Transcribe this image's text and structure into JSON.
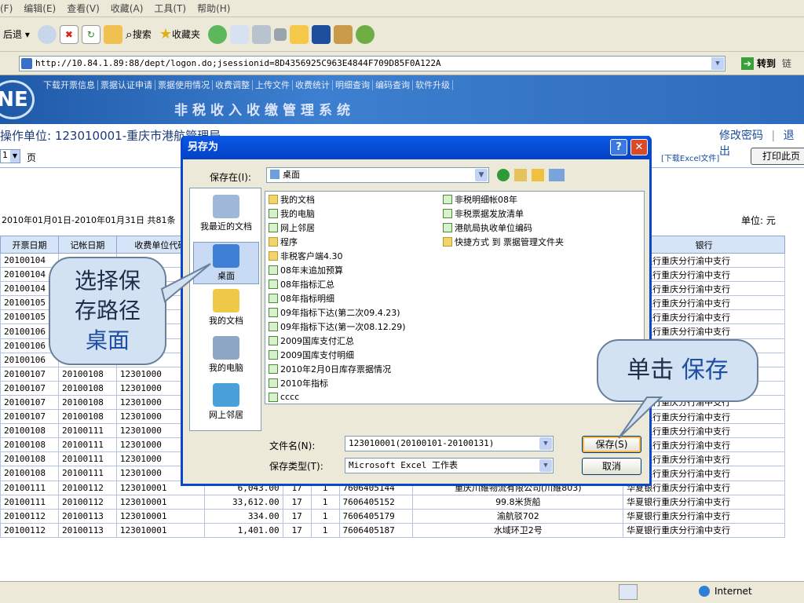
{
  "menu": [
    "(F)",
    "编辑(E)",
    "查看(V)",
    "收藏(A)",
    "工具(T)",
    "帮助(H)"
  ],
  "toolbar": {
    "back": "后退",
    "search": "搜索",
    "favorites": "收藏夹"
  },
  "address": {
    "label": "址(D)",
    "url": "http://10.84.1.89:88/dept/logon.do;jsessionid=8D4356925C963E4844F709D85F0A122A",
    "go": "转到",
    "links": "链"
  },
  "banner": {
    "logo": "NE",
    "nav": [
      "下载开票信息",
      "票据认证申请",
      "票据使用情况",
      "收费调整",
      "上传文件",
      "收费统计",
      "明细查询",
      "编码查询",
      "软件升级"
    ],
    "system_title": "非税收入收缴管理系统"
  },
  "opbar": {
    "unit_label": "操作单位: 123010001-重庆市港航管理局",
    "change_pwd": "修改密码",
    "logout": "退出"
  },
  "pagebar": {
    "page_value": "1",
    "page_suffix": "页",
    "download_excel": "[下载Excel文件]",
    "print": "打印此页"
  },
  "summary": {
    "date_range": "2010年01月01日-2010年01月31日  共81条",
    "unit": "单位: 元"
  },
  "table": {
    "headers": [
      "开票日期",
      "记帐日期",
      "收费单位代码",
      "",
      "",
      "",
      "",
      "",
      "银行"
    ],
    "rows": [
      [
        "20100104",
        "",
        "",
        "",
        "",
        "",
        "",
        "",
        "华夏银行重庆分行渝中支行"
      ],
      [
        "20100104",
        "",
        "",
        "",
        "",
        "",
        "",
        "",
        "华夏银行重庆分行渝中支行"
      ],
      [
        "20100104",
        "",
        "",
        "",
        "",
        "",
        "",
        "",
        "华夏银行重庆分行渝中支行"
      ],
      [
        "20100105",
        "",
        "",
        "",
        "",
        "",
        "",
        "",
        "华夏银行重庆分行渝中支行"
      ],
      [
        "20100105",
        "",
        "",
        "",
        "",
        "",
        "",
        "",
        "华夏银行重庆分行渝中支行"
      ],
      [
        "20100106",
        "",
        "",
        "",
        "",
        "",
        "",
        "",
        "华夏银行重庆分行渝中支行"
      ],
      [
        "20100106",
        "",
        "",
        "",
        "",
        "",
        "",
        "",
        "行"
      ],
      [
        "20100106",
        "",
        "",
        "",
        "",
        "",
        "",
        "",
        "行"
      ],
      [
        "20100107",
        "20100108",
        "12301000",
        "",
        "",
        "",
        "",
        "",
        "行"
      ],
      [
        "20100107",
        "20100108",
        "12301000",
        "",
        "",
        "",
        "",
        "",
        "行"
      ],
      [
        "20100107",
        "20100108",
        "12301000",
        "",
        "",
        "",
        "",
        "",
        "华夏银行重庆分行渝中支行"
      ],
      [
        "20100107",
        "20100108",
        "12301000",
        "",
        "",
        "",
        "",
        "",
        "华夏银行重庆分行渝中支行"
      ],
      [
        "20100108",
        "20100111",
        "12301000",
        "",
        "",
        "",
        "",
        "",
        "华夏银行重庆分行渝中支行"
      ],
      [
        "20100108",
        "20100111",
        "12301000",
        "",
        "",
        "",
        "",
        "",
        "华夏银行重庆分行渝中支行"
      ],
      [
        "20100108",
        "20100111",
        "12301000",
        "",
        "",
        "",
        "",
        "",
        "华夏银行重庆分行渝中支行"
      ],
      [
        "20100108",
        "20100111",
        "12301000",
        "",
        "",
        "",
        "",
        "",
        "华夏银行重庆分行渝中支行"
      ],
      [
        "20100111",
        "20100112",
        "123010001",
        "6,043.00",
        "17",
        "1",
        "7606405144",
        "重庆川維物流有限公司(川維803)",
        "华夏银行重庆分行渝中支行"
      ],
      [
        "20100111",
        "20100112",
        "123010001",
        "33,612.00",
        "17",
        "1",
        "7606405152",
        "99.8米货船",
        "华夏银行重庆分行渝中支行"
      ],
      [
        "20100112",
        "20100113",
        "123010001",
        "334.00",
        "17",
        "1",
        "7606405179",
        "渝航驳702",
        "华夏银行重庆分行渝中支行"
      ],
      [
        "20100112",
        "20100113",
        "123010001",
        "1,401.00",
        "17",
        "1",
        "7606405187",
        "水域环卫2号",
        "华夏银行重庆分行渝中支行"
      ]
    ]
  },
  "status": {
    "zone": "Internet"
  },
  "dialog": {
    "title": "另存为",
    "save_in_label": "保存在(I):",
    "save_in_value": "桌面",
    "places": [
      "我最近的文档",
      "桌面",
      "我的文档",
      "我的电脑",
      "网上邻居"
    ],
    "files_col1": [
      "我的文档",
      "我的电脑",
      "网上邻居",
      "程序",
      "非税客户端4.30",
      "08年末追加预算",
      "08年指标汇总",
      "08年指标明细",
      "09年指标下达(第二次09.4.23)",
      "09年指标下达(第一次08.12.29)",
      "2009国库支付汇总",
      "2009国库支付明细",
      "2010年2月0日库存票据情况",
      "2010年指标",
      "cccc"
    ],
    "files_col2": [
      "非税明细帐08年",
      "非税票据发放清单",
      "港航局执收单位编码",
      "快捷方式 到 票据管理文件夹"
    ],
    "filename_label": "文件名(N):",
    "filename_value": "123010001(20100101-20100131)",
    "filetype_label": "保存类型(T):",
    "filetype_value": "Microsoft Excel 工作表",
    "save_button": "保存(S)",
    "cancel_button": "取消"
  },
  "callouts": {
    "left_line1": "选择保",
    "left_line2": "存路径",
    "left_line3": "桌面",
    "right_prefix": "单击",
    "right_em": "保存"
  }
}
